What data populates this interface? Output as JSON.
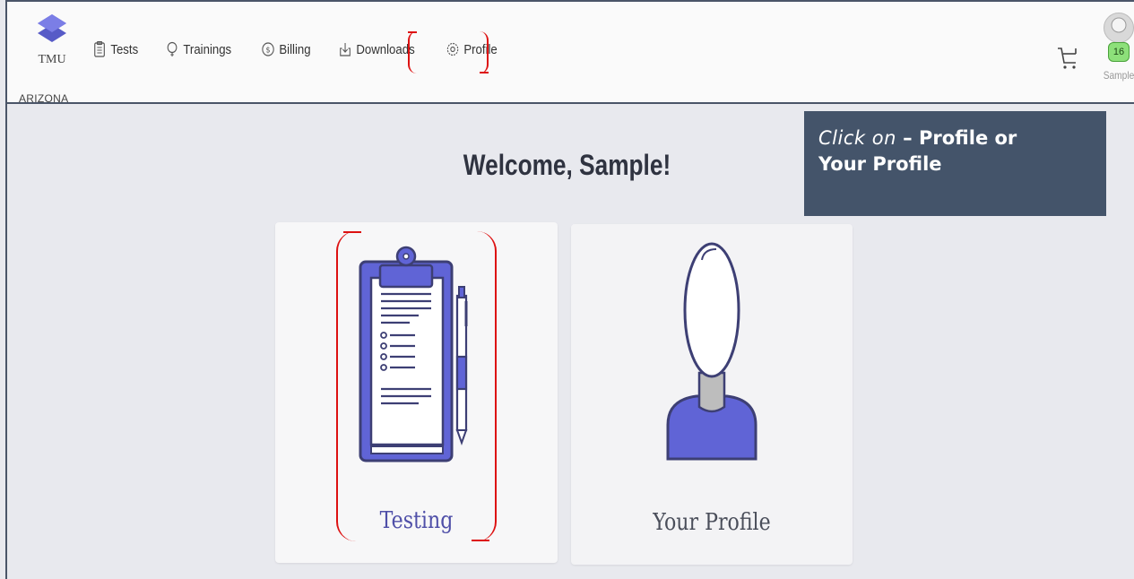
{
  "brand": {
    "name": "TMU",
    "state": "ARIZONA"
  },
  "nav": {
    "items": [
      {
        "label": "Tests",
        "icon": "clipboard-icon"
      },
      {
        "label": "Trainings",
        "icon": "lightbulb-icon"
      },
      {
        "label": "Billing",
        "icon": "dollar-icon"
      },
      {
        "label": "Downloads",
        "icon": "download-icon"
      },
      {
        "label": "Profile",
        "icon": "gear-icon"
      }
    ]
  },
  "user": {
    "name": "Sample",
    "badge_count": "16"
  },
  "main": {
    "welcome": "Welcome, Sample!",
    "cards": [
      {
        "label": "Testing",
        "icon": "clipboard-test-icon"
      },
      {
        "label": "Your Profile",
        "icon": "user-silhouette-icon"
      }
    ]
  },
  "callout": {
    "italic": "Click on",
    "dash": " – ",
    "text1": "Profile or",
    "text2": "Your Profile"
  },
  "colors": {
    "accent": "#5c5fd6",
    "highlight_red": "#dd1111",
    "callout_bg": "#44546a",
    "badge_green": "#8de07a"
  }
}
